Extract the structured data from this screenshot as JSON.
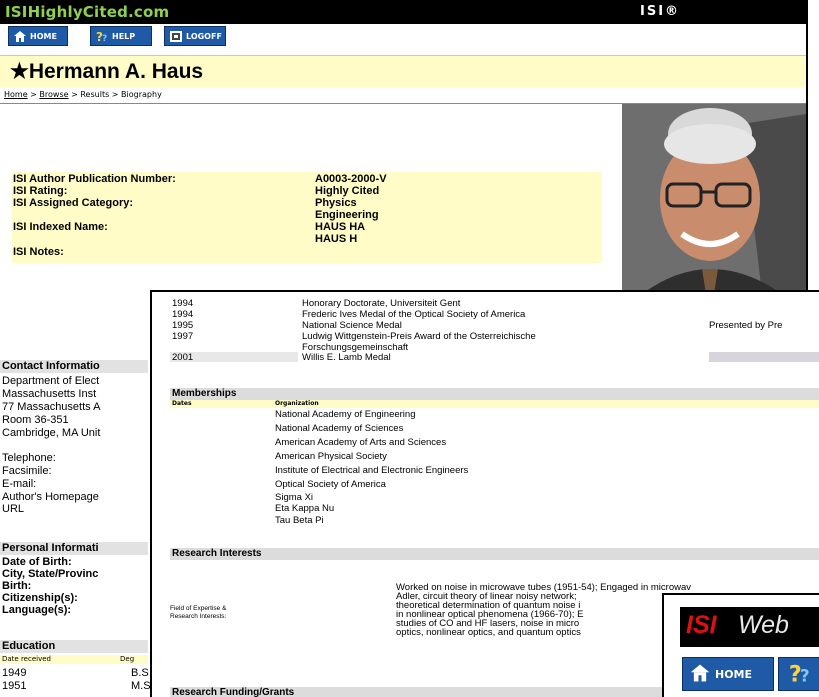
{
  "header": {
    "brand": "ISIHighlyCited.com",
    "isi_mark": "ISI®"
  },
  "nav": {
    "home": "HOME",
    "help": "HELP",
    "logoff": "LOGOFF"
  },
  "title": "★Hermann A. Haus",
  "breadcrumb": {
    "home": "Home",
    "browse": "Browse",
    "results": "Results",
    "current": "Biography",
    "sep": ">"
  },
  "info": {
    "labels": [
      "ISI Author Publication Number:",
      "ISI Rating:",
      "ISI Assigned Category:",
      "ISI Indexed Name:",
      "ISI Notes:"
    ],
    "pub_number": "A0003-2000-V",
    "rating": "Highly Cited",
    "category_1": "Physics",
    "category_2": "Engineering",
    "indexed_1": "HAUS HA",
    "indexed_2": "HAUS H"
  },
  "contact": {
    "heading": "Contact Informatio",
    "lines": [
      "Department of Elect",
      "Massachusetts Inst",
      "77 Massachusetts A",
      "Room 36-351",
      "Cambridge, MA Unit"
    ],
    "telephone": "Telephone:",
    "facsimile": "Facsimile:",
    "email": "E-mail:",
    "homepage": "Author's Homepage",
    "url": "URL"
  },
  "personal": {
    "heading": "Personal Informati",
    "dob": "Date of Birth:",
    "city": "City, State/Provinc",
    "birth": "Birth:",
    "citizenship": "Citizenship(s):",
    "languages": "Language(s):"
  },
  "education": {
    "heading": "Education",
    "col_date": "Date received",
    "col_degree": "Deg",
    "rows": [
      {
        "year": "1949",
        "degree": "B.S"
      },
      {
        "year": "1951",
        "degree": "M.S"
      }
    ]
  },
  "honors": [
    {
      "year": "1994",
      "award": "Honorary Doctorate, Universiteit Gent",
      "note": ""
    },
    {
      "year": "1994",
      "award": "Frederic Ives Medal of the Optical Society of America",
      "note": ""
    },
    {
      "year": "1995",
      "award": "National Science Medal",
      "note": "Presented by Pre"
    },
    {
      "year": "1997",
      "award": "Ludwig Wittgenstein-Preis Award of the Osterreichische",
      "note": ""
    },
    {
      "year": "",
      "award": "Forschungsgemeinschaft",
      "note": ""
    },
    {
      "year": "2001",
      "award": "Willis E. Lamb Medal",
      "note": ""
    }
  ],
  "memberships": {
    "heading": "Memberships",
    "col_dates": "Dates",
    "col_org": "Organization",
    "items": [
      "National Academy of Engineering",
      "National Academy of Sciences",
      "American Academy of Arts and Sciences",
      "American Physical Society",
      "Institute of Electrical and Electronic Engineers",
      "Optical Society of America",
      "Sigma Xi",
      "Eta Kappa Nu",
      "Tau Beta Pi"
    ]
  },
  "research": {
    "heading": "Research Interests",
    "label_1": "Field of Expertise &",
    "label_2": "Research Interests:",
    "lines": [
      "Worked on noise in microwave tubes (1951-54); Engaged in microwav",
      "Adler, circuit theory of linear noisy network;",
      "theoretical determination of quantum noise i",
      "in nonlinear optical phenomena (1966-70); E",
      "studies of CO and HF lasers, noise in micro",
      "optics, nonlinear optics, and quantum optics"
    ]
  },
  "funding": {
    "heading": "Research Funding/Grants"
  },
  "popup": {
    "logo_isi": "ISI",
    "logo_web": "Web",
    "home": "HOME"
  }
}
